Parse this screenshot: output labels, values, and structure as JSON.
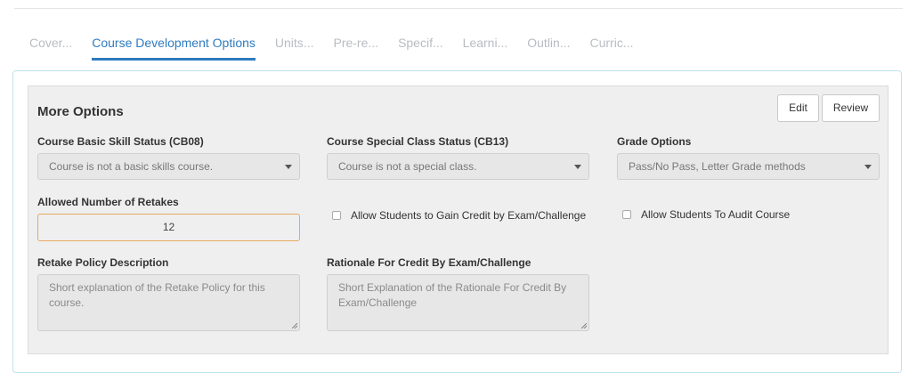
{
  "tabs": [
    {
      "label": "Cover..."
    },
    {
      "label": "Course Development Options"
    },
    {
      "label": "Units..."
    },
    {
      "label": "Pre-re..."
    },
    {
      "label": "Specif..."
    },
    {
      "label": "Learni..."
    },
    {
      "label": "Outlin..."
    },
    {
      "label": "Curric..."
    }
  ],
  "panel": {
    "title": "More Options",
    "edit_label": "Edit",
    "review_label": "Review"
  },
  "fields": {
    "basic_skill": {
      "label": "Course Basic Skill Status (CB08)",
      "value": "Course is not a basic skills course."
    },
    "special_class": {
      "label": "Course Special Class Status (CB13)",
      "value": "Course is not a special class."
    },
    "grade_options": {
      "label": "Grade Options",
      "value": "Pass/No Pass, Letter Grade methods"
    },
    "retakes": {
      "label": "Allowed Number of Retakes",
      "value": "12"
    },
    "credit_by_exam": {
      "label": "Allow Students to Gain Credit by Exam/Challenge",
      "checked": false
    },
    "audit": {
      "label": "Allow Students To Audit Course",
      "checked": false
    },
    "retake_policy": {
      "label": "Retake Policy Description",
      "placeholder": "Short explanation of the Retake Policy for this course."
    },
    "rationale": {
      "label": "Rationale For Credit By Exam/Challenge",
      "placeholder": "Short Explanation of the Rationale For Credit By Exam/Challenge"
    }
  },
  "colors": {
    "accent": "#2f7bbf",
    "tab_inactive": "#b8bdc2",
    "focus_border": "#e6a95f",
    "panel_bg": "#efefef"
  }
}
